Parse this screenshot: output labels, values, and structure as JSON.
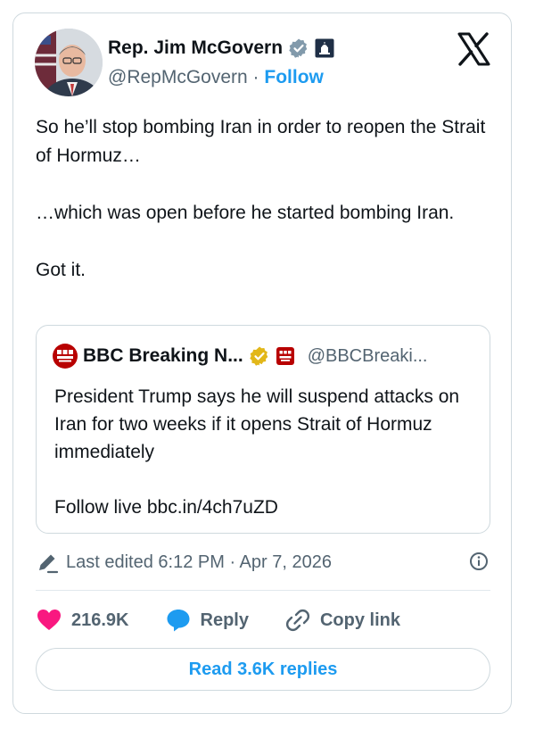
{
  "author": {
    "name": "Rep. Jim McGovern",
    "handle": "@RepMcGovern",
    "separator": "·",
    "follow_label": "Follow"
  },
  "tweet": {
    "lines": [
      "So he’ll stop bombing Iran in order to reopen the Strait of Hormuz…",
      "…which was open before he started bombing Iran.",
      "Got it."
    ]
  },
  "quote": {
    "name": "BBC Breaking N...",
    "handle": "@BBCBreaki...",
    "avatar_text": "BBC NEWS BREAKING",
    "text": "President Trump says he will suspend attacks on Iran for two weeks if it opens Strait of Hormuz immediately",
    "link_line": "Follow live bbc.in/4ch7uZD"
  },
  "meta": {
    "edited": "Last edited 6:12 PM · Apr 7, 2026"
  },
  "actions": {
    "likes": "216.9K",
    "reply_label": "Reply",
    "copy_label": "Copy link"
  },
  "read_replies": "Read 3.6K replies",
  "colors": {
    "accent": "#1d9bf0",
    "like": "#f91880",
    "verified_blue": "#1d9bf0",
    "verified_gold": "#e2b719",
    "bbc_red": "#b80000"
  },
  "icons": [
    "verified-badge-icon",
    "government-icon",
    "x-logo-icon",
    "pencil-icon",
    "info-icon",
    "heart-icon",
    "reply-bubble-icon",
    "link-icon"
  ]
}
